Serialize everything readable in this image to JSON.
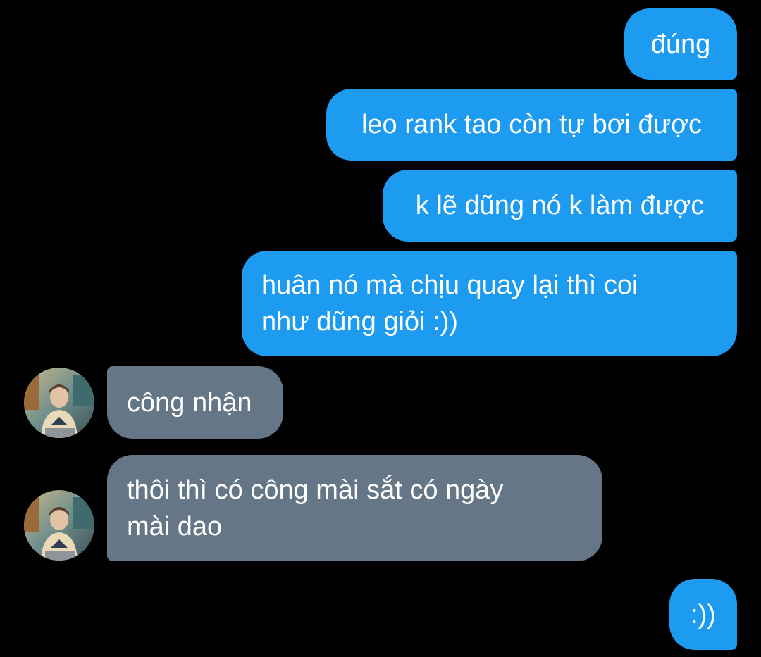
{
  "colors": {
    "background": "#000000",
    "outgoing_bubble": "#1d9bf0",
    "incoming_bubble": "#657786",
    "text": "#ffffff"
  },
  "messages": [
    {
      "direction": "outgoing",
      "text": "đúng"
    },
    {
      "direction": "outgoing",
      "text": "leo rank tao còn tự bơi được"
    },
    {
      "direction": "outgoing",
      "text": "k lẽ dũng nó k làm được"
    },
    {
      "direction": "outgoing",
      "text": "huân nó mà chịu quay lại thì coi\nnhư dũng giỏi :))"
    },
    {
      "direction": "incoming",
      "text": "công nhận",
      "avatar": "contact-avatar"
    },
    {
      "direction": "incoming",
      "text": "thôi thì có công mài sắt có ngày\nmài dao",
      "avatar": "contact-avatar"
    },
    {
      "direction": "outgoing",
      "text": ":))"
    }
  ]
}
